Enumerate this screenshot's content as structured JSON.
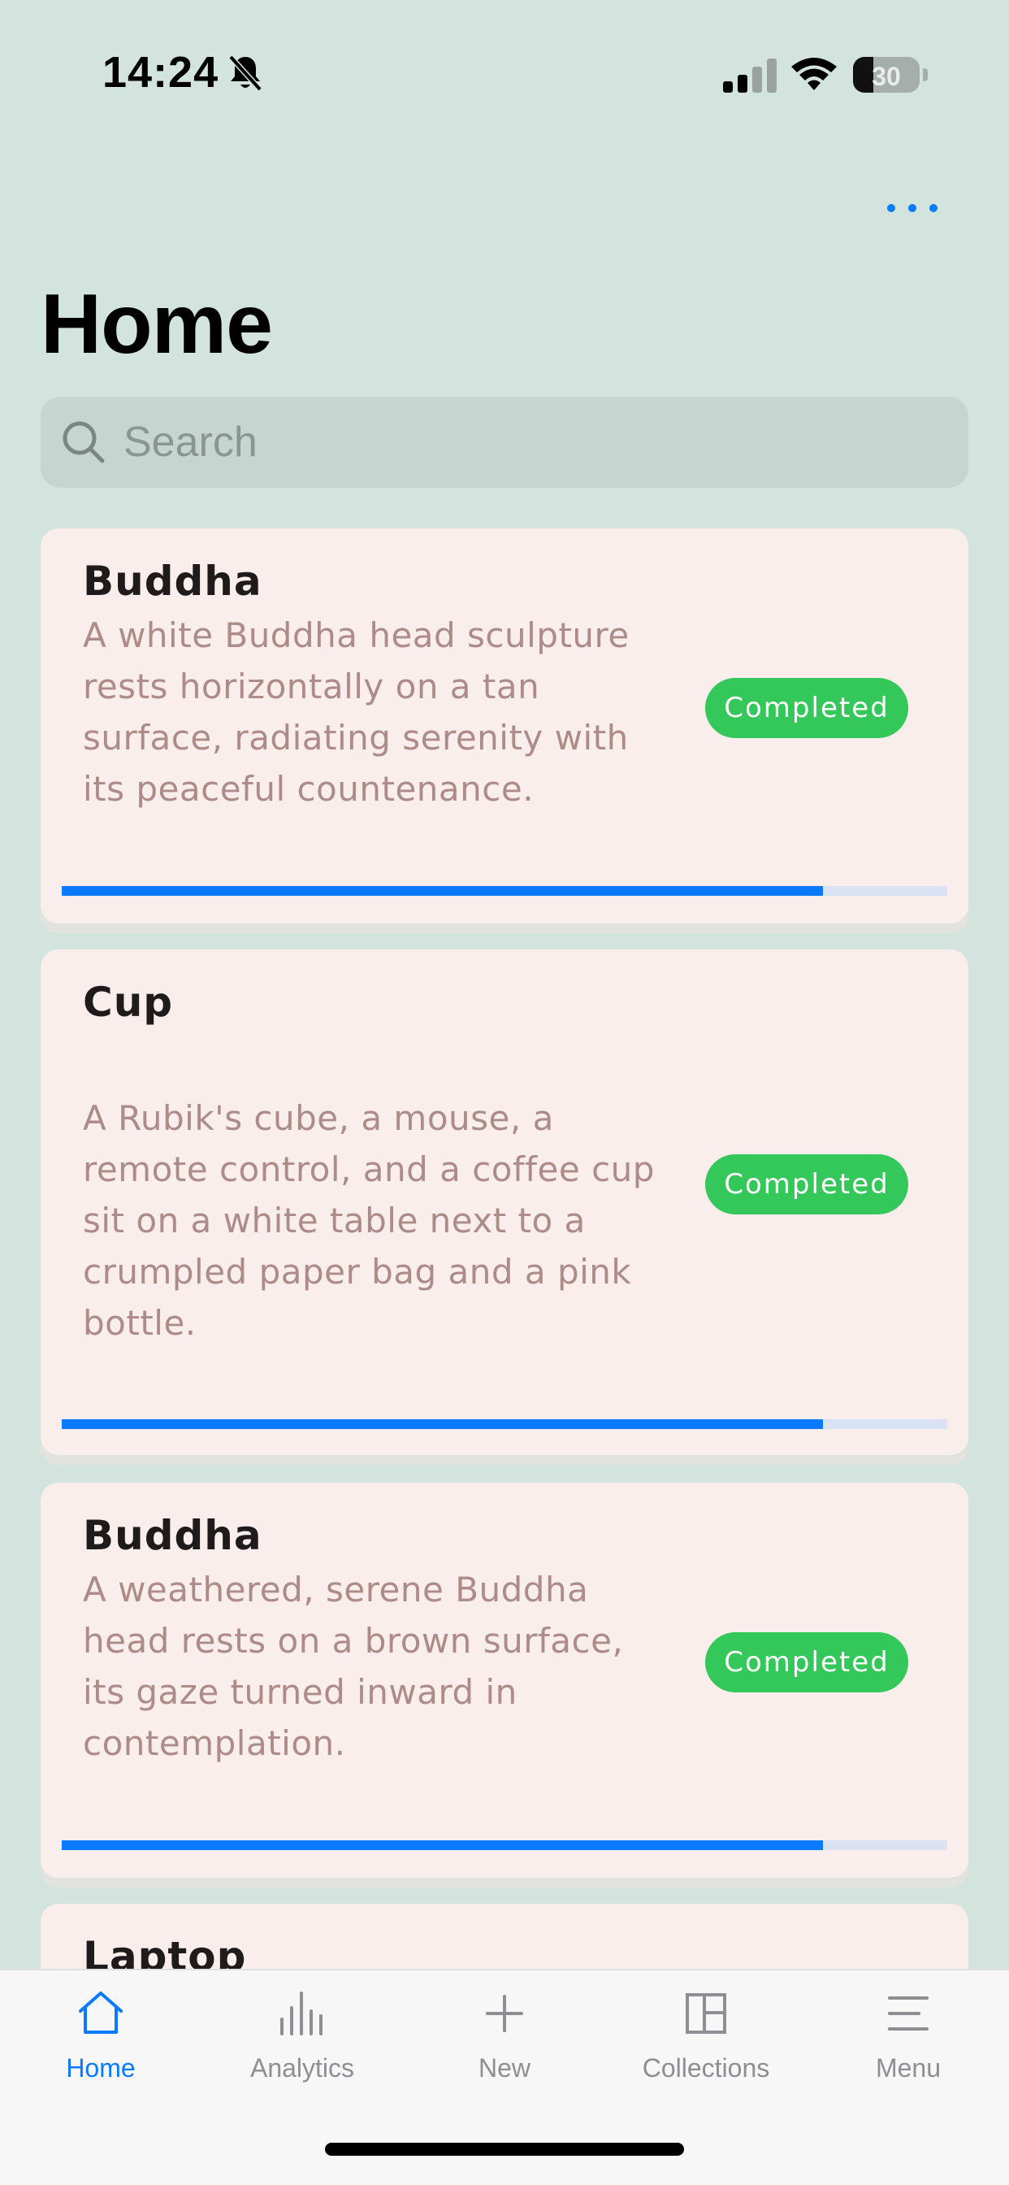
{
  "status": {
    "time": "14:24",
    "battery": "30"
  },
  "page": {
    "title": "Home"
  },
  "search": {
    "placeholder": "Search"
  },
  "items": [
    {
      "title": "Buddha",
      "description": "A white Buddha head sculpture rests horizontally on a tan surface, radiating serenity with its peaceful countenance.",
      "status": "Completed",
      "progress": 0.86
    },
    {
      "title": "Cup",
      "description": "A Rubik's cube, a mouse, a remote control, and a coffee cup sit on a white table next to a crumpled paper bag and a pink bottle.",
      "status": "Completed",
      "progress": 0.86
    },
    {
      "title": "Buddha",
      "description": "A weathered, serene Buddha head rests on a brown surface, its gaze turned inward in contemplation.",
      "status": "Completed",
      "progress": 0.86
    },
    {
      "title": "Laptop"
    }
  ],
  "tabs": [
    {
      "label": "Home",
      "icon": "house-icon",
      "active": true
    },
    {
      "label": "Analytics",
      "icon": "bar-chart-icon",
      "active": false
    },
    {
      "label": "New",
      "icon": "plus-icon",
      "active": false
    },
    {
      "label": "Collections",
      "icon": "layout-icon",
      "active": false
    },
    {
      "label": "Menu",
      "icon": "menu-icon",
      "active": false
    }
  ],
  "colors": {
    "accent": "#0a7aff",
    "badge": "#34c759",
    "background": "#d3e4de",
    "card": "#f9eeec"
  }
}
